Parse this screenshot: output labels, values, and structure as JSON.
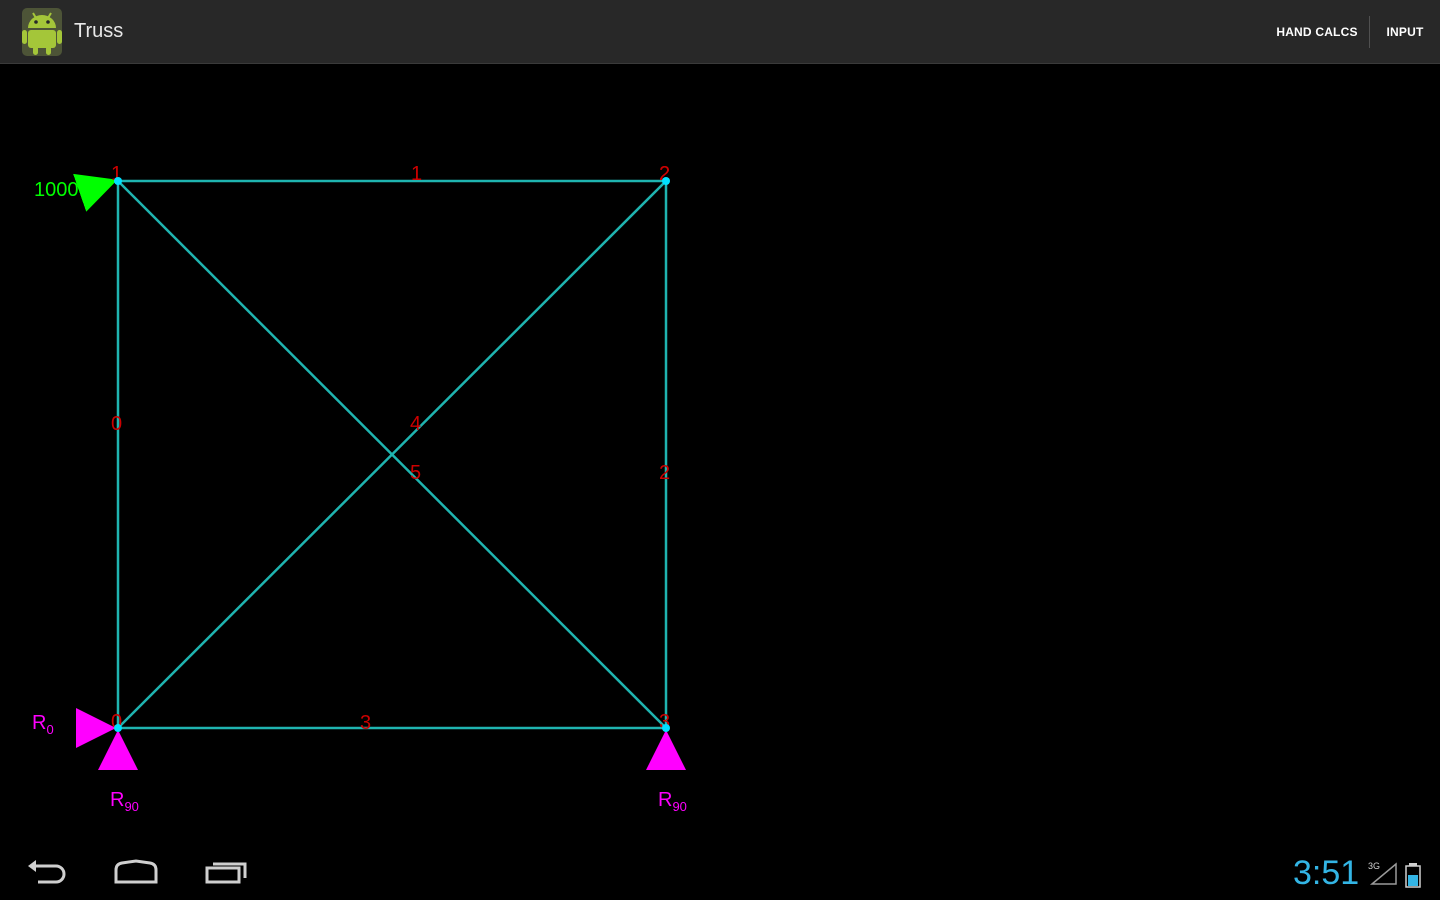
{
  "app": {
    "title": "Truss",
    "actions": [
      "HAND CALCS",
      "INPUT"
    ]
  },
  "truss": {
    "member_labels": [
      "1",
      "2",
      "0",
      "4",
      "5",
      "2",
      "3"
    ],
    "node_labels": [
      "1",
      "2",
      "0",
      "3"
    ],
    "load": {
      "label": "1000",
      "color": "#00ff00"
    },
    "reactions": [
      {
        "base": "R",
        "sub": "0",
        "color": "#ff00ff"
      },
      {
        "base": "R",
        "sub": "90",
        "color": "#ff00ff"
      },
      {
        "base": "R",
        "sub": "90",
        "color": "#ff00ff"
      }
    ],
    "colors": {
      "member": "#1fb4b0",
      "node": "#00e0ff",
      "label": "#cc0000"
    }
  },
  "status_bar": {
    "time": "3:51",
    "signal_label": "3G"
  },
  "icons": {
    "app": "android-icon",
    "nav": [
      "back-icon",
      "home-icon",
      "recents-icon"
    ],
    "status": [
      "signal-icon",
      "battery-icon"
    ]
  }
}
